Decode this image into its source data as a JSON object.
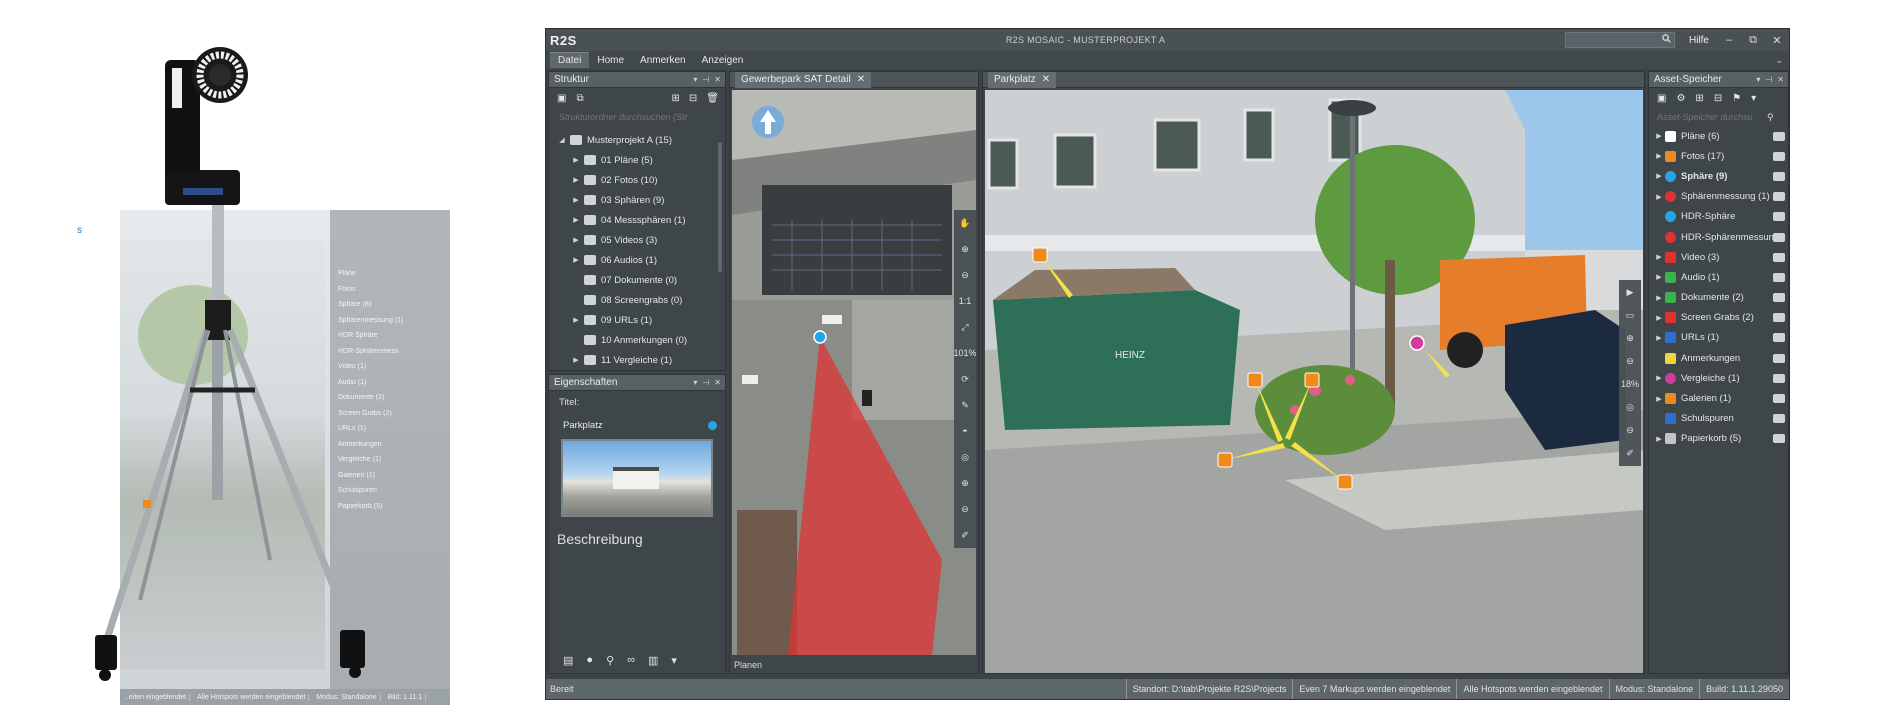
{
  "photo": {
    "stray_mark": "s",
    "faded_list": [
      "Pläne",
      "Fotos",
      "Sphäre (8)",
      "Sphärenmessung (1)",
      "HDR Sphäre",
      "HDR-Sphärenmess",
      "Video (1)",
      "Audio (1)",
      "Dokumente (2)",
      "Screen Grabs (2)",
      "URLs (1)",
      "Anmerkungen",
      "Vergleiche (1)",
      "Galerien (1)",
      "Schulspuren",
      "Papierkorb (5)"
    ],
    "faded_status": [
      "..eiten eingeblendet",
      "Alle Hotspots werden eingeblendet",
      "Modus: Standalone",
      "Bild: 1.11.1"
    ]
  },
  "app": {
    "logo": "R2S",
    "title": "R2S MOSAIC - MUSTERPROJEKT A",
    "help": "Hilfe",
    "window_buttons": [
      "–",
      "⧉",
      "✕"
    ],
    "menu": [
      "Datei",
      "Home",
      "Anmerken",
      "Anzeigen"
    ],
    "collapse_glyph": "⌄"
  },
  "structure": {
    "title": "Struktur",
    "filter_placeholder": "Strukturordner durchsuchen (Str",
    "tree": [
      {
        "label": "Musterprojekt A (15)",
        "level": 0,
        "tw": "◢"
      },
      {
        "label": "01 Pläne (5)",
        "level": 1,
        "tw": "▶"
      },
      {
        "label": "02 Fotos (10)",
        "level": 1,
        "tw": "▶"
      },
      {
        "label": "03 Sphären (9)",
        "level": 1,
        "tw": "▶"
      },
      {
        "label": "04 Messsphären (1)",
        "level": 1,
        "tw": "▶"
      },
      {
        "label": "05 Videos (3)",
        "level": 1,
        "tw": "▶"
      },
      {
        "label": "06 Audios (1)",
        "level": 1,
        "tw": "▶"
      },
      {
        "label": "07 Dokumente (0)",
        "level": 1,
        "tw": ""
      },
      {
        "label": "08 Screengrabs (0)",
        "level": 1,
        "tw": ""
      },
      {
        "label": "09 URLs (1)",
        "level": 1,
        "tw": "▶"
      },
      {
        "label": "10 Anmerkungen (0)",
        "level": 1,
        "tw": ""
      },
      {
        "label": "11 Vergleiche (1)",
        "level": 1,
        "tw": "▶"
      }
    ]
  },
  "properties": {
    "title": "Eigenschaften",
    "title_label": "Titel:",
    "title_value": "Parkplatz",
    "description_label": "Beschreibung"
  },
  "mapview": {
    "tab": "Gewerbepark SAT Detail",
    "footer": "Planen",
    "zoom": "101%",
    "tool_one": "1:1"
  },
  "photoview": {
    "tab": "Parkplatz",
    "zoom": "18%",
    "container_text": "HEINZ"
  },
  "assets": {
    "title": "Asset-Speicher",
    "filter_placeholder": "Asset-Speicher durchsu",
    "items": [
      {
        "label": "Pläne (6)",
        "color": "#ffffff",
        "shape": "square",
        "tw": "▶",
        "bold": false
      },
      {
        "label": "Fotos (17)",
        "color": "#f08a1c",
        "shape": "square",
        "tw": "▶",
        "bold": false
      },
      {
        "label": "Sphäre (9)",
        "color": "#23a6e6",
        "shape": "round",
        "tw": "▶",
        "bold": true
      },
      {
        "label": "Sphärenmessung (1)",
        "color": "#e23131",
        "shape": "round",
        "tw": "▶",
        "bold": false
      },
      {
        "label": "HDR-Sphäre",
        "color": "#23a6e6",
        "shape": "round",
        "tw": "",
        "bold": false
      },
      {
        "label": "HDR-Sphärenmessung",
        "color": "#e23131",
        "shape": "round",
        "tw": "",
        "bold": false
      },
      {
        "label": "Video (3)",
        "color": "#e23131",
        "shape": "square",
        "tw": "▶",
        "bold": false
      },
      {
        "label": "Audio (1)",
        "color": "#3bb34a",
        "shape": "square",
        "tw": "▶",
        "bold": false
      },
      {
        "label": "Dokumente (2)",
        "color": "#3bb34a",
        "shape": "square",
        "tw": "▶",
        "bold": false
      },
      {
        "label": "Screen Grabs (2)",
        "color": "#e23131",
        "shape": "square",
        "tw": "▶",
        "bold": false
      },
      {
        "label": "URLs (1)",
        "color": "#2d6fd1",
        "shape": "square",
        "tw": "▶",
        "bold": false
      },
      {
        "label": "Anmerkungen",
        "color": "#f2d437",
        "shape": "square",
        "tw": "",
        "bold": false
      },
      {
        "label": "Vergleiche (1)",
        "color": "#d23a9e",
        "shape": "round",
        "tw": "▶",
        "bold": false
      },
      {
        "label": "Galerien (1)",
        "color": "#f08a1c",
        "shape": "square",
        "tw": "▶",
        "bold": false
      },
      {
        "label": "Schulspuren",
        "color": "#2d6fd1",
        "shape": "square",
        "tw": "",
        "bold": false
      },
      {
        "label": "Papierkorb (5)",
        "color": "#bfc5c8",
        "shape": "square",
        "tw": "▶",
        "bold": false
      }
    ]
  },
  "statusbar": {
    "left": "Bereit",
    "segments": [
      "Standort: D:\\tab\\Projekte R2S\\Projects",
      "Even 7 Markups werden eingeblendet",
      "Alle Hotspots werden eingeblendet",
      "Modus: Standalone",
      "Build: 1.11.1.29050"
    ]
  },
  "colors": {
    "accent_blue": "#23a6e6",
    "hotspot_orange": "#f08a1c",
    "fov_red": "#e23131",
    "ui_dark": "#3c4246"
  }
}
